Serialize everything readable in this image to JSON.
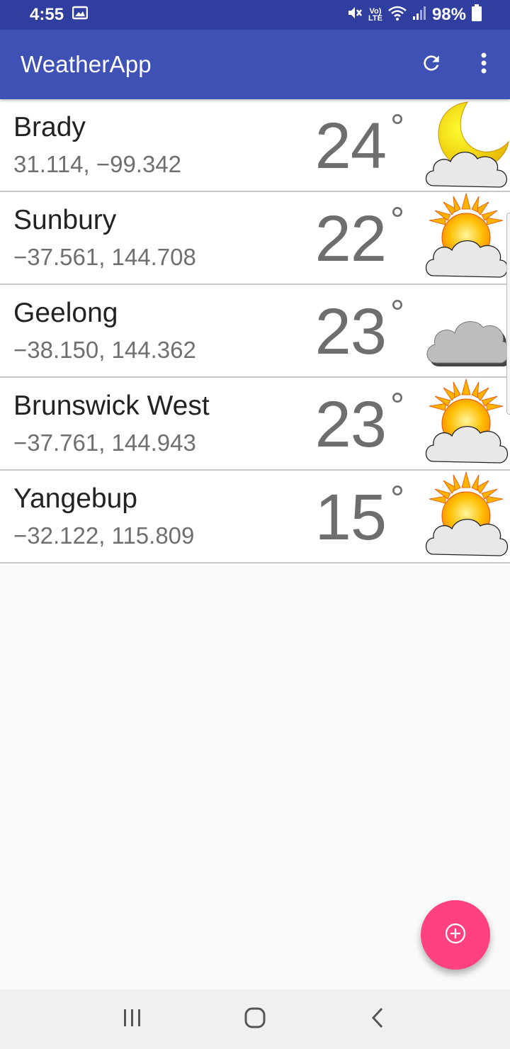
{
  "status_bar": {
    "time": "4:55",
    "battery": "98%",
    "icons": [
      "image-icon",
      "mute-icon",
      "volte-icon",
      "wifi-icon",
      "signal-icon",
      "battery-icon"
    ]
  },
  "app_bar": {
    "title": "WeatherApp",
    "actions": [
      "refresh-icon",
      "more-vert-icon"
    ]
  },
  "locations": [
    {
      "name": "Brady",
      "coords": "31.114, −99.342",
      "temp": "24",
      "icon": "moon-cloud-icon"
    },
    {
      "name": "Sunbury",
      "coords": "−37.561, 144.708",
      "temp": "22",
      "icon": "sun-cloud-icon"
    },
    {
      "name": "Geelong",
      "coords": "−38.150, 144.362",
      "temp": "23",
      "icon": "cloud-icon"
    },
    {
      "name": "Brunswick West",
      "coords": "−37.761, 144.943",
      "temp": "23",
      "icon": "sun-cloud-icon"
    },
    {
      "name": "Yangebup",
      "coords": "−32.122, 115.809",
      "temp": "15",
      "icon": "sun-cloud-icon"
    }
  ],
  "degree_symbol": "°",
  "fab": {
    "icon": "add-icon"
  },
  "nav_bar": {
    "buttons": [
      "recents-icon",
      "home-icon",
      "back-icon"
    ]
  },
  "colors": {
    "primary": "#3f51b5",
    "primary_dark": "#303f9f",
    "accent": "#ff4081"
  }
}
